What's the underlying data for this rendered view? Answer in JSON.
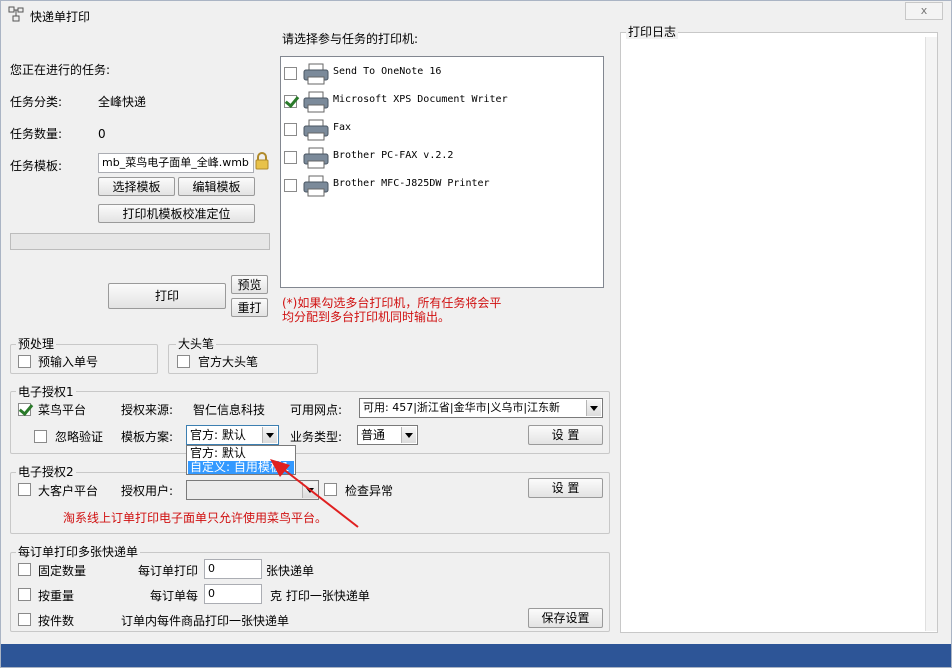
{
  "window": {
    "title": "快递单打印",
    "close_label": "x"
  },
  "task": {
    "current_task_label": "您正在进行的任务:",
    "category_label": "任务分类:",
    "category_value": "全峰快递",
    "count_label": "任务数量:",
    "count_value": "0",
    "template_label": "任务模板:",
    "template_value": "mb_菜鸟电子面单_全峰.wmb",
    "select_template_button": "选择模板",
    "edit_template_button": "编辑模板",
    "calibrate_button": "打印机模板校准定位",
    "print_button": "打印",
    "preview_button": "预览",
    "reprint_button": "重打"
  },
  "printers": {
    "heading": "请选择参与任务的打印机:",
    "items": [
      {
        "name": "Send To OneNote 16",
        "checked": false
      },
      {
        "name": "Microsoft XPS Document Writer",
        "checked": true
      },
      {
        "name": "Fax",
        "checked": false
      },
      {
        "name": "Brother PC-FAX v.2.2",
        "checked": false
      },
      {
        "name": "Brother MFC-J825DW Printer",
        "checked": false
      }
    ],
    "note_line1": "(*)如果勾选多台打印机，所有任务将会平",
    "note_line2": "均分配到多台打印机同时输出。"
  },
  "log": {
    "title": "打印日志"
  },
  "preprocess": {
    "title": "预处理",
    "option": "预输入单号"
  },
  "bigpen": {
    "title": "大头笔",
    "option": "官方大头笔"
  },
  "auth1": {
    "title": "电子授权1",
    "cainiao_label": "菜鸟平台",
    "cainiao_checked": true,
    "source_label": "授权来源:",
    "source_value": "智仁信息科技",
    "outlet_label": "可用网点:",
    "outlet_value": "可用: 457|浙江省|金华市|义乌市|江东新",
    "ignore_label": "忽略验证",
    "scheme_label": "模板方案:",
    "scheme_value": "官方: 默认",
    "business_label": "业务类型:",
    "business_value": "普通",
    "settings_button": "设 置",
    "scheme_options": [
      "官方: 默认",
      "自定义: 自用模板1"
    ]
  },
  "auth2": {
    "title": "电子授权2",
    "bigclient_label": "大客户平台",
    "user_label": "授权用户:",
    "user_value": "",
    "check_label": "检查异常",
    "settings_button": "设 置",
    "warning": "淘系线上订单打印电子面单只允许使用菜鸟平台。"
  },
  "multi": {
    "title": "每订单打印多张快递单",
    "fixed_label": "固定数量",
    "per_order_label": "每订单打印",
    "per_order_value": "0",
    "per_order_unit": "张快递单",
    "weight_label": "按重量",
    "per_weight_label": "每订单每",
    "per_weight_value": "0",
    "per_weight_unit": "克 打印一张快递单",
    "pieces_label": "按件数",
    "pieces_desc": "订单内每件商品打印一张快递单",
    "save_button": "保存设置"
  },
  "colors": {
    "warning_red": "#d01010",
    "taskbar_blue": "#2d5597",
    "highlight": "#3399ff",
    "arrow_red": "#e02020"
  }
}
